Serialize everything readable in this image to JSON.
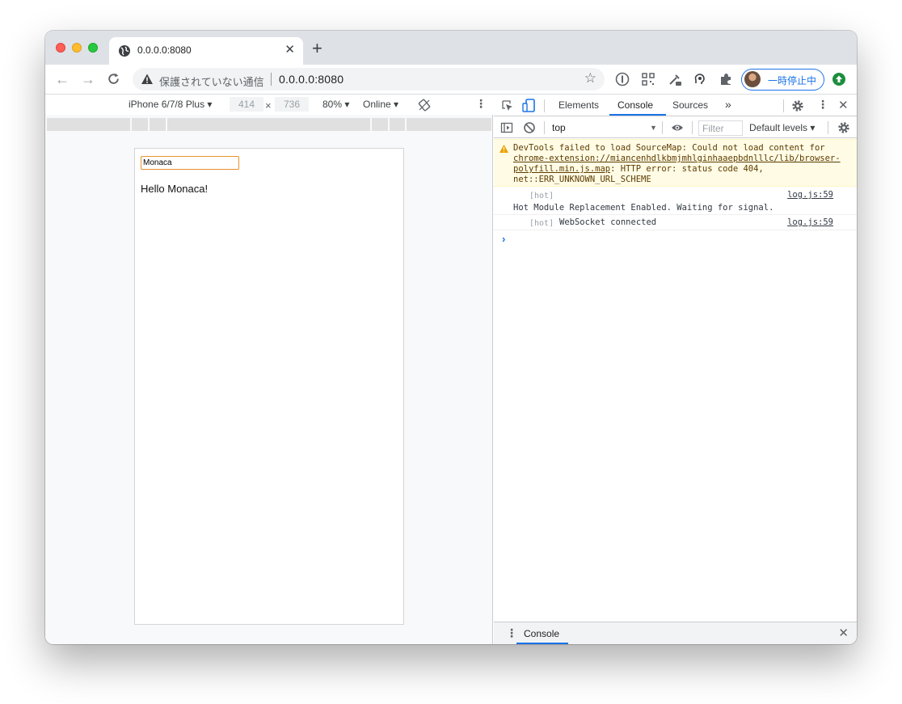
{
  "browser": {
    "tab_title": "0.0.0.0:8080",
    "tab_close": "✕",
    "new_tab": "+",
    "security_label": "保護されていない通信",
    "url": "0.0.0.0:8080",
    "profile_status": "一時停止中",
    "colors": {
      "accent": "#1a73e8",
      "tab_strip": "#dee1e6",
      "update": "#1e8e3e"
    }
  },
  "device_toolbar": {
    "device": "iPhone 6/7/8 Plus ▾",
    "width": "414",
    "height": "736",
    "times": "×",
    "zoom": "80% ▾",
    "throttle": "Online ▾"
  },
  "page": {
    "input_value": "Monaca",
    "greeting": "Hello Monaca!"
  },
  "devtools": {
    "tabs": [
      "Elements",
      "Console",
      "Sources"
    ],
    "more_tabs": "»",
    "active_tab": "Console",
    "context": "top",
    "filter_placeholder": "Filter",
    "levels": "Default levels ▾",
    "messages": [
      {
        "level": "warning",
        "text_prefix": "DevTools failed to load SourceMap: Could not load content for ",
        "link": "chrome-extension://miancenhdlkbmjmhlginhaaepbdnlllc/lib/browser-polyfill.min.js.map",
        "text_suffix": ": HTTP error: status code 404, net::ERR_UNKNOWN_URL_SCHEME"
      },
      {
        "level": "log",
        "tag": "[hot]",
        "text": "Hot Module Replacement Enabled. Waiting for signal.",
        "source": "log.js:59"
      },
      {
        "level": "log",
        "tag": "[hot]",
        "text": "WebSocket connected",
        "source": "log.js:59"
      }
    ],
    "prompt": "›",
    "drawer_tab": "Console",
    "drawer_close": "✕"
  }
}
